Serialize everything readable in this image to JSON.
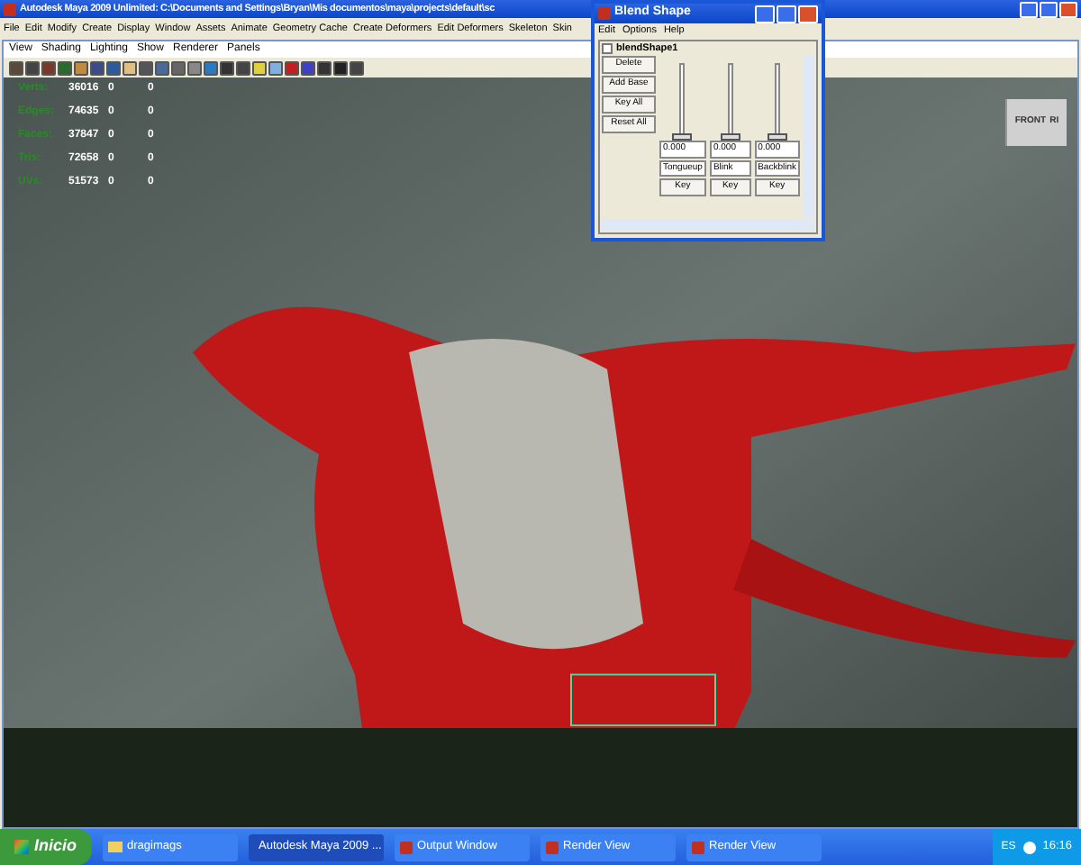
{
  "window": {
    "title": "Autodesk Maya 2009 Unlimited: C:\\Documents and Settings\\Bryan\\Mis documentos\\maya\\projects\\default\\sc"
  },
  "menu_bar": [
    "File",
    "Edit",
    "Modify",
    "Create",
    "Display",
    "Window",
    "Assets",
    "Animate",
    "Geometry Cache",
    "Create Deformers",
    "Edit Deformers",
    "Skeleton",
    "Skin"
  ],
  "panel_menu": [
    "View",
    "Shading",
    "Lighting",
    "Show",
    "Renderer",
    "Panels"
  ],
  "hud_stats": [
    {
      "label": "Verts:",
      "values": [
        "36016",
        "0",
        "0"
      ]
    },
    {
      "label": "Edges:",
      "values": [
        "74635",
        "0",
        "0"
      ]
    },
    {
      "label": "Faces:",
      "values": [
        "37847",
        "0",
        "0"
      ]
    },
    {
      "label": "Tris:",
      "values": [
        "72658",
        "0",
        "0"
      ]
    },
    {
      "label": "UVs:",
      "values": [
        "51573",
        "0",
        "0"
      ]
    }
  ],
  "view_cube": {
    "front": "FRONT",
    "side": "RI"
  },
  "blend_shape_window": {
    "title": "Blend Shape",
    "menu": [
      "Edit",
      "Options",
      "Help"
    ],
    "node": "blendShape1",
    "buttons": [
      "Delete",
      "Add Base",
      "Key All",
      "Reset All"
    ],
    "targets": [
      {
        "value": "0.000",
        "name": "Tongueup",
        "level": 0,
        "key": "Key"
      },
      {
        "value": "0.000",
        "name": "Blink",
        "level": 0,
        "key": "Key"
      },
      {
        "value": "0.000",
        "name": "Backblink",
        "level": 0,
        "key": "Key"
      }
    ]
  },
  "taskbar": {
    "start": "Inicio",
    "items": [
      {
        "label": "dragimags",
        "selected": false,
        "kind": "folder"
      },
      {
        "label": "Autodesk Maya 2009 ...",
        "selected": true,
        "kind": "app"
      },
      {
        "label": "Output Window",
        "selected": false,
        "kind": "app"
      },
      {
        "label": "Render View",
        "selected": false,
        "kind": "app"
      },
      {
        "label": "Render View",
        "selected": false,
        "kind": "app"
      }
    ],
    "language": "ES",
    "clock": "16:16"
  }
}
